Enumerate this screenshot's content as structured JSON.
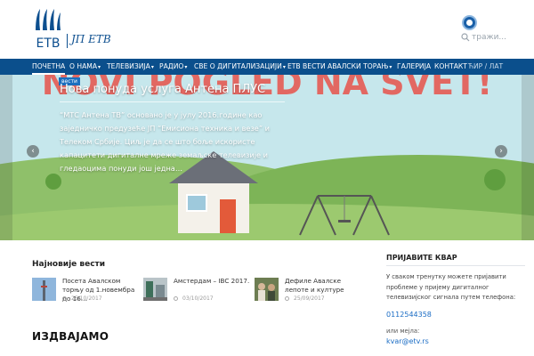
{
  "header": {
    "logo_text": "ЕТВ",
    "org_name": "ЈП ЕТВ",
    "badge_icon": "award-badge-icon",
    "search": {
      "placeholder": "тражи..."
    }
  },
  "nav": {
    "items": [
      {
        "label": "ПОЧЕТНА",
        "dropdown": false
      },
      {
        "label": "О НАМА",
        "dropdown": true
      },
      {
        "label": "ТЕЛЕВИЗИЈА",
        "dropdown": true
      },
      {
        "label": "РАДИО",
        "dropdown": true
      },
      {
        "label": "СВЕ О ДИГИТАЛИЗАЦИЈИ",
        "dropdown": true
      },
      {
        "label": "ЕТВ ВЕСТИ",
        "dropdown": false
      },
      {
        "label": "АВАЛСКИ ТОРАЊ",
        "dropdown": true
      },
      {
        "label": "ГАЛЕРИЈА",
        "dropdown": false
      },
      {
        "label": "КОНТАКТ",
        "dropdown": false
      }
    ],
    "lang": "ЋИР / ЛАТ",
    "caret": "▾",
    "colors": {
      "bar": "#0b4f8c",
      "accent": "#1b6fbf"
    }
  },
  "hero": {
    "category": "вести",
    "title": "Нова понуда услуга Антена ПЛУС",
    "description": "“МТС Антена ТВ” основано је у јулу 2016.године као заједничко предузеће ЈП “Емисиона техника и везе” и Телеком Србије. Циљ је да се што боље искористе капацитети дигиталне мреже земаљске телевизије и гледаоцима понуди још једна…",
    "banner_text": "NOVI POGLED NA SVET!",
    "prev_arrow": "‹",
    "next_arrow": "›"
  },
  "latest": {
    "title": "Најновије вести",
    "items": [
      {
        "title": "Посета Авалском торњу од 1.новембра до 16…",
        "date": "25/10/2017",
        "icon": "tower-thumb-icon"
      },
      {
        "title": "Амстердам – IBC 2017.",
        "date": "03/10/2017",
        "icon": "exhibition-thumb-icon"
      },
      {
        "title": "Дефиле Авалске лепоте и културе",
        "date": "25/09/2017",
        "icon": "event-thumb-icon"
      }
    ]
  },
  "featured": {
    "title": "ИЗДВАЈАМО"
  },
  "sidebar": {
    "title": "ПРИЈАВИТЕ КВАР",
    "description": "У сваком тренутку можете пријавити проблеме у пријему дигиталног телевизијског сигнала путем телефона:",
    "phone": "0112544358",
    "or_label": "или мејла:",
    "email": "kvar@etv.rs"
  }
}
